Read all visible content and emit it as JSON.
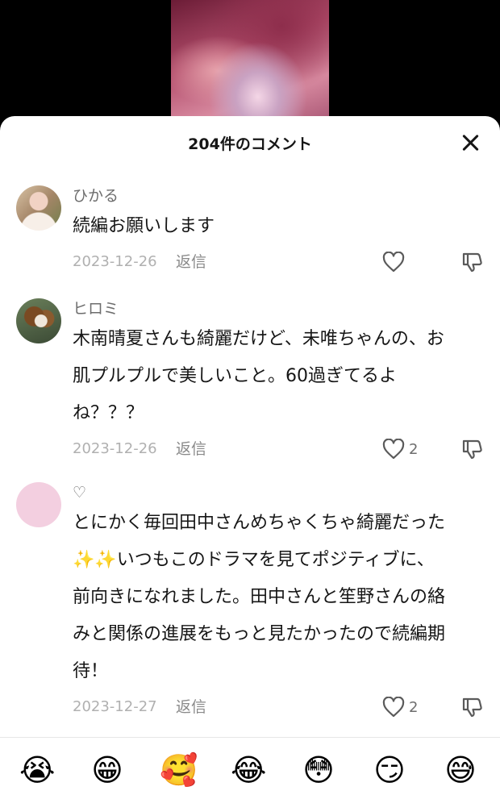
{
  "sheet": {
    "title": "204件のコメント"
  },
  "comments": [
    {
      "user": "ひかる",
      "text_lines": [
        "続編お願いします"
      ],
      "date": "2023-12-26",
      "reply": "返信",
      "likes": ""
    },
    {
      "user": "ヒロミ",
      "text_lines": [
        "木南晴夏さんも綺麗だけど、未唯ちゃんの、お",
        "肌プルプルで美しいこと。60過ぎてるよ",
        "ね？？？"
      ],
      "date": "2023-12-26",
      "reply": "返信",
      "likes": "2"
    },
    {
      "user": "♡",
      "text_lines": [
        "とにかく毎回田中さんめちゃくちゃ綺麗だった",
        "✨✨いつもこのドラマを見てポジティブに、",
        "前向きになれました。田中さんと笙野さんの絡",
        "みと関係の進展をもっと見たかったので続編期",
        "待！"
      ],
      "date": "2023-12-27",
      "reply": "返信",
      "likes": "2"
    }
  ],
  "emoji_bar": {
    "items": [
      "😭",
      "😁",
      "🥰",
      "😂",
      "😳",
      "😏",
      "😅"
    ],
    "colors": {
      "face": "#ffcb4c"
    }
  },
  "colors": {
    "accent_text": "#161616",
    "secondary_text": "#6d6d6d",
    "date_text": "#b0b0b0"
  }
}
